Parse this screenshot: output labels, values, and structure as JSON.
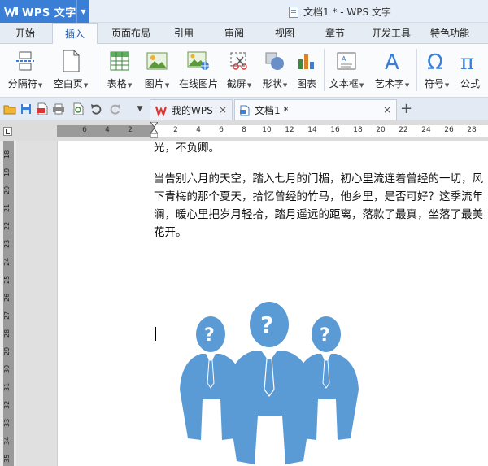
{
  "app": {
    "name": "WPS 文字",
    "window_title": "文档1 * - WPS 文字"
  },
  "menu": {
    "tabs": [
      "开始",
      "插入",
      "页面布局",
      "引用",
      "审阅",
      "视图",
      "章节",
      "开发工具",
      "特色功能"
    ],
    "active": "插入"
  },
  "ribbon": {
    "items": [
      {
        "label": "分隔符",
        "icon": "page-break-icon",
        "dropdown": true
      },
      {
        "label": "空白页",
        "icon": "blank-page-icon",
        "dropdown": true
      },
      {
        "label": "表格",
        "icon": "table-icon",
        "dropdown": true
      },
      {
        "label": "图片",
        "icon": "picture-icon",
        "dropdown": true
      },
      {
        "label": "在线图片",
        "icon": "online-picture-icon",
        "dropdown": false
      },
      {
        "label": "截屏",
        "icon": "screenshot-icon",
        "dropdown": true
      },
      {
        "label": "形状",
        "icon": "shapes-icon",
        "dropdown": true
      },
      {
        "label": "图表",
        "icon": "chart-icon",
        "dropdown": false
      },
      {
        "label": "文本框",
        "icon": "textbox-icon",
        "dropdown": true
      },
      {
        "label": "艺术字",
        "icon": "wordart-icon",
        "dropdown": true
      },
      {
        "label": "符号",
        "icon": "symbol-icon",
        "dropdown": true
      },
      {
        "label": "公式",
        "icon": "formula-icon",
        "dropdown": false
      }
    ]
  },
  "doc_tabs": [
    {
      "label": "我的WPS",
      "icon": "wps-logo-icon"
    },
    {
      "label": "文档1 *",
      "icon": "document-icon",
      "active": true
    }
  ],
  "ruler": {
    "h_ticks": [
      "6",
      "4",
      "2",
      "2",
      "4",
      "6",
      "8",
      "10",
      "12",
      "14",
      "16",
      "18",
      "20",
      "22",
      "24",
      "26",
      "28"
    ],
    "v_ticks": [
      "18",
      "19",
      "20",
      "21",
      "22",
      "23",
      "24",
      "25",
      "26",
      "27",
      "28",
      "29",
      "30",
      "31",
      "32",
      "33",
      "34",
      "35"
    ]
  },
  "document": {
    "lines": [
      "光，不负卿。",
      "当告别六月的天空，踏入七月的门楣，初心里流连着曾经的一切，风",
      "下青梅的那个夏天，拾忆曾经的竹马，他乡里，是否可好？这季流年",
      "澜，暖心里把岁月轻拾，踏月遥远的距离，落款了最真，坐落了最美",
      "花开。"
    ]
  },
  "colors": {
    "accent": "#3a7fd5",
    "figure": "#5b9bd5"
  }
}
